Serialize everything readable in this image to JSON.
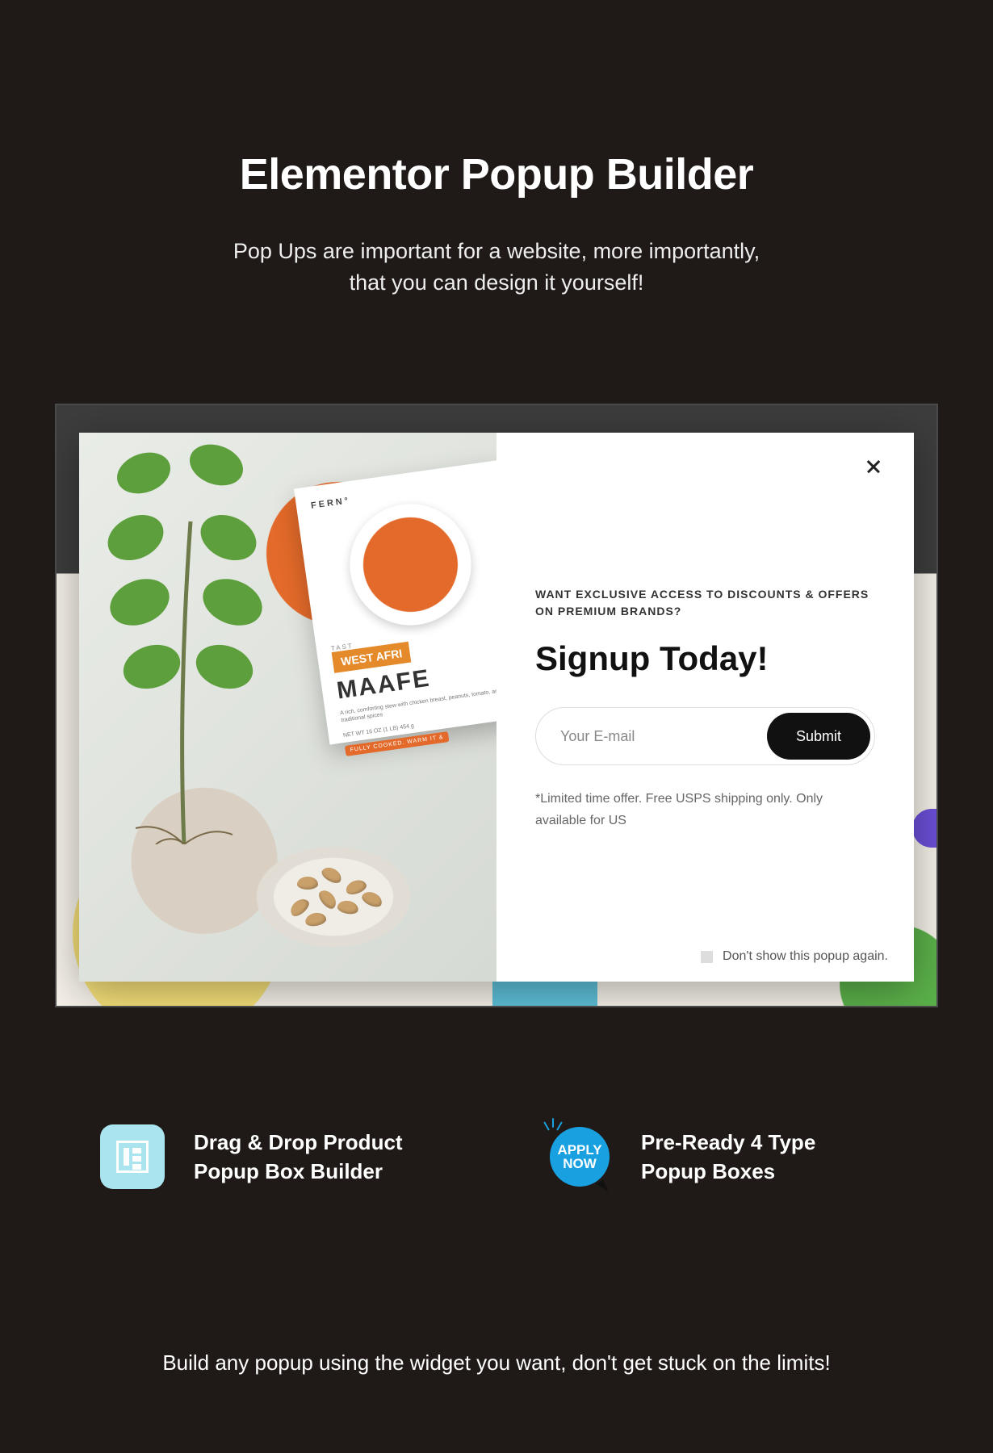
{
  "hero": {
    "title": "Elementor Popup Builder",
    "subtitle_line1": "Pop Ups are important for a website, more importantly,",
    "subtitle_line2": "that you can design it yourself!"
  },
  "popup": {
    "package": {
      "brand": "FERN°",
      "ribbon": "WEST AFRI",
      "name": "MAAFE",
      "desc": "A rich, comforting stew with chicken breast, peanuts, tomato, and traditional spices",
      "weight": "NET WT 16 OZ (1 LB) 454 g",
      "cooked": "FULLY COOKED. WARM IT &"
    },
    "eyebrow": "WANT EXCLUSIVE ACCESS TO DISCOUNTS & OFFERS ON PREMIUM BRANDS?",
    "heading": "Signup Today!",
    "email_placeholder": "Your E-mail",
    "submit": "Submit",
    "disclaimer": "*Limited time offer. Free USPS shipping only. Only available for US",
    "dont_show": "Don't show this popup again."
  },
  "features": [
    {
      "line1": "Drag & Drop Product",
      "line2": "Popup Box Builder"
    },
    {
      "badge1": "APPLY",
      "badge2": "NOW",
      "line1": "Pre-Ready 4 Type",
      "line2": "Popup  Boxes"
    }
  ],
  "footer": "Build any popup using the widget you want, don't get stuck on the limits!"
}
